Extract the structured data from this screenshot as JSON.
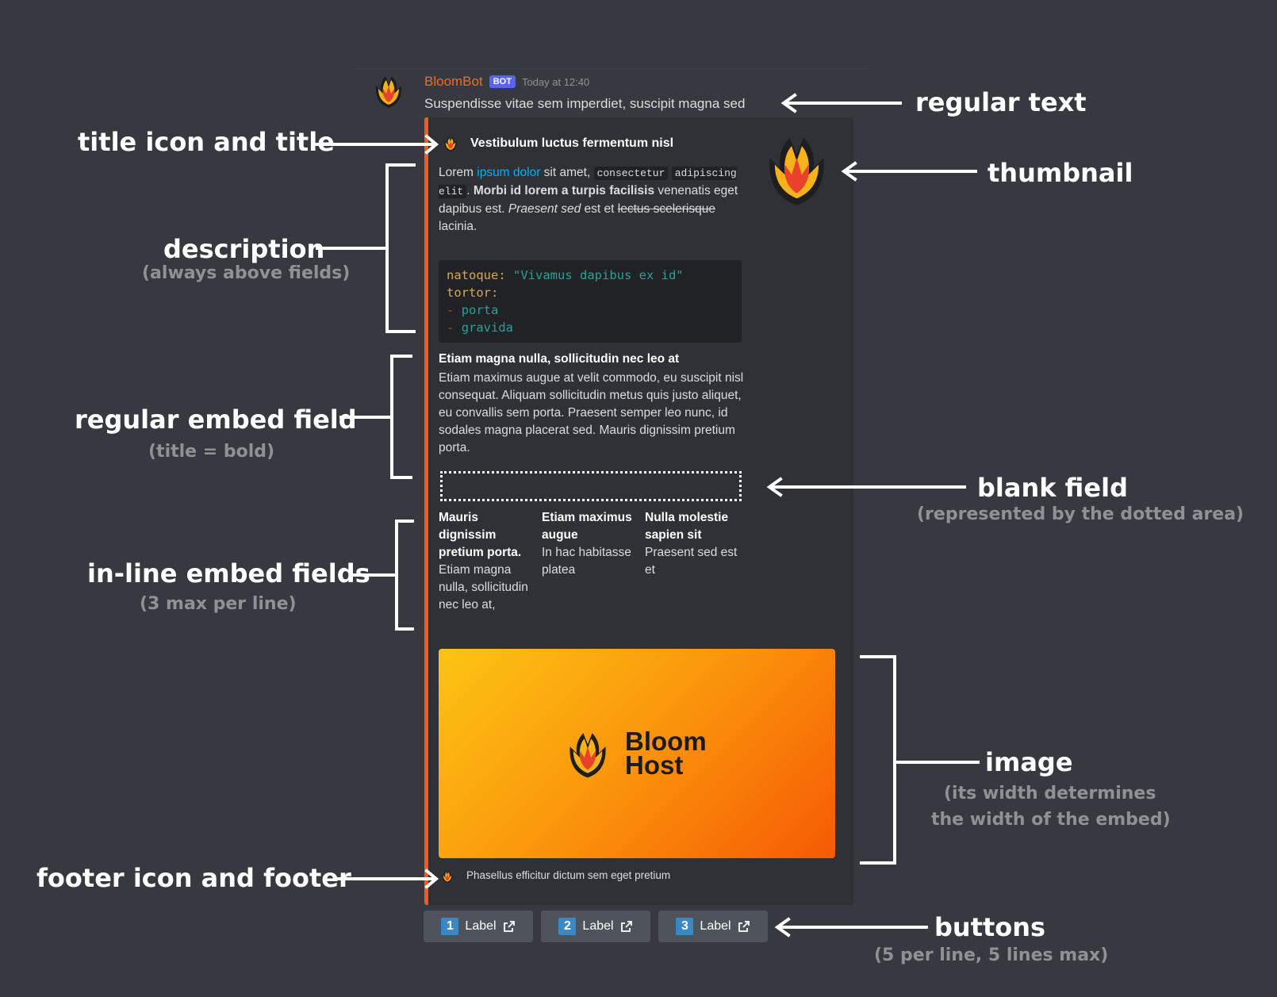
{
  "message": {
    "author": "BloomBot",
    "badge": "BOT",
    "timestamp": "Today at 12:40",
    "text": "Suspendisse vitae sem imperdiet, suscipit magna sed"
  },
  "embed": {
    "title": "Vestibulum luctus fermentum nisl",
    "description": {
      "p1": "Lorem ",
      "link": "ipsum dolor",
      "p2": " sit amet, ",
      "code1": "consectetur",
      "code2": "adipiscing elit",
      "p3": ". ",
      "bold": "Morbi id lorem a turpis facilisis",
      "p4": " venenatis eget dapibus est. ",
      "italic": "Praesent sed",
      "p5": " est et ",
      "strike": "lectus scelerisque",
      "p6": " lacinia."
    },
    "codeblock": {
      "k1": "natoque:",
      "s1": "\"Vivamus dapibus ex id\"",
      "k2": "tortor:",
      "dash": "-",
      "i1": "porta",
      "i2": "gravida"
    },
    "field": {
      "title": "Etiam magna nulla, sollicitudin nec leo at",
      "value": "Etiam maximus augue at velit commodo, eu suscipit nisl consequat. Aliquam sollicitudin metus quis justo aliquet, eu convallis sem porta. Praesent semper leo nunc, id sodales magna placerat sed. Mauris dignissim pretium porta."
    },
    "inline_fields": [
      {
        "title": "Mauris dignissim pretium porta.",
        "value": "Etiam magna nulla, sollicitudin nec leo at,"
      },
      {
        "title": "Etiam maximus augue",
        "value": "In hac habitasse platea"
      },
      {
        "title": "Nulla molestie sapien sit",
        "value": "Praesent sed est et"
      }
    ],
    "image_text": {
      "line1": "Bloom",
      "line2": "Host"
    },
    "footer": "Phasellus efficitur dictum sem eget pretium"
  },
  "buttons": [
    {
      "num": "1",
      "label": "Label"
    },
    {
      "num": "2",
      "label": "Label"
    },
    {
      "num": "3",
      "label": "Label"
    }
  ],
  "annotations": {
    "regular_text": "regular text",
    "title_icon": "title icon and title",
    "thumbnail": "thumbnail",
    "description": "description",
    "description_sub": "(always above fields)",
    "regular_field": "regular embed field",
    "regular_field_sub": "(title = bold)",
    "blank_field": "blank field",
    "blank_field_sub": "(represented by the dotted area)",
    "inline_fields": "in-line embed fields",
    "inline_fields_sub": "(3 max per line)",
    "image": "image",
    "image_sub1": "(its width determines",
    "image_sub2": "the width of the embed)",
    "footer": "footer icon and footer",
    "buttons": "buttons",
    "buttons_sub": "(5 per line, 5 lines max)"
  },
  "colors": {
    "embed_accent": "#f05a1a",
    "link": "#00aff4",
    "bot_badge": "#5865f2",
    "author": "#f06a2a"
  }
}
